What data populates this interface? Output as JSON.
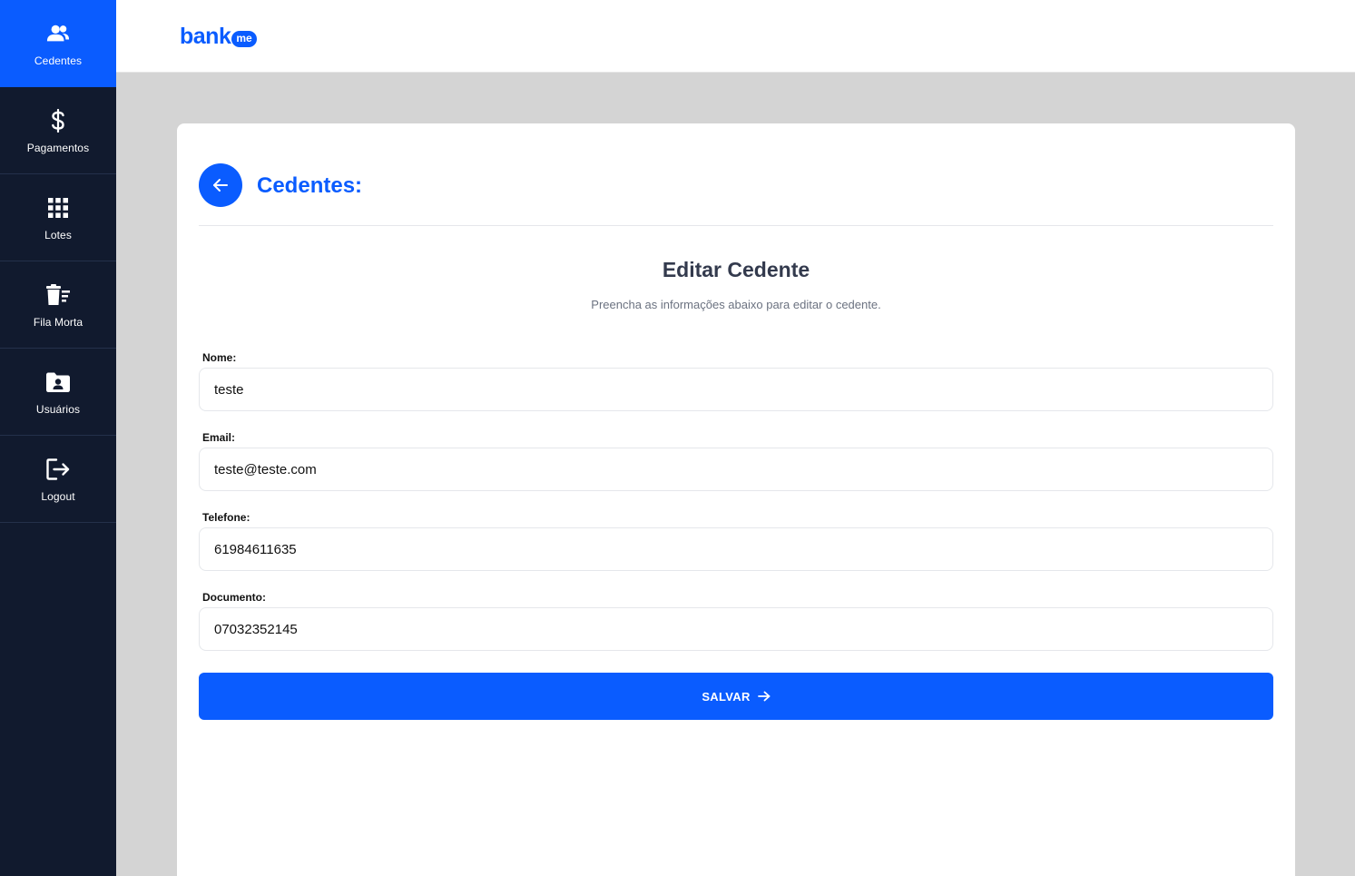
{
  "sidebar": {
    "items": [
      {
        "label": "Cedentes",
        "icon": "users-icon",
        "active": true
      },
      {
        "label": "Pagamentos",
        "icon": "dollar-icon",
        "active": false
      },
      {
        "label": "Lotes",
        "icon": "grid-icon",
        "active": false
      },
      {
        "label": "Fila Morta",
        "icon": "trash-list-icon",
        "active": false
      },
      {
        "label": "Usuários",
        "icon": "folder-user-icon",
        "active": false
      },
      {
        "label": "Logout",
        "icon": "logout-icon",
        "active": false
      }
    ]
  },
  "header": {
    "logo_text": "bank",
    "logo_badge": "me"
  },
  "card": {
    "title": "Cedentes:",
    "form_title": "Editar Cedente",
    "form_subtitle": "Preencha as informações abaixo para editar o cedente.",
    "fields": [
      {
        "label": "Nome:",
        "value": "teste"
      },
      {
        "label": "Email:",
        "value": "teste@teste.com"
      },
      {
        "label": "Telefone:",
        "value": "61984611635"
      },
      {
        "label": "Documento:",
        "value": "07032352145"
      }
    ],
    "save_label": "SALVAR"
  },
  "colors": {
    "primary": "#0a5cff",
    "sidebar_bg": "#111a2e",
    "page_bg": "#d4d4d4"
  }
}
